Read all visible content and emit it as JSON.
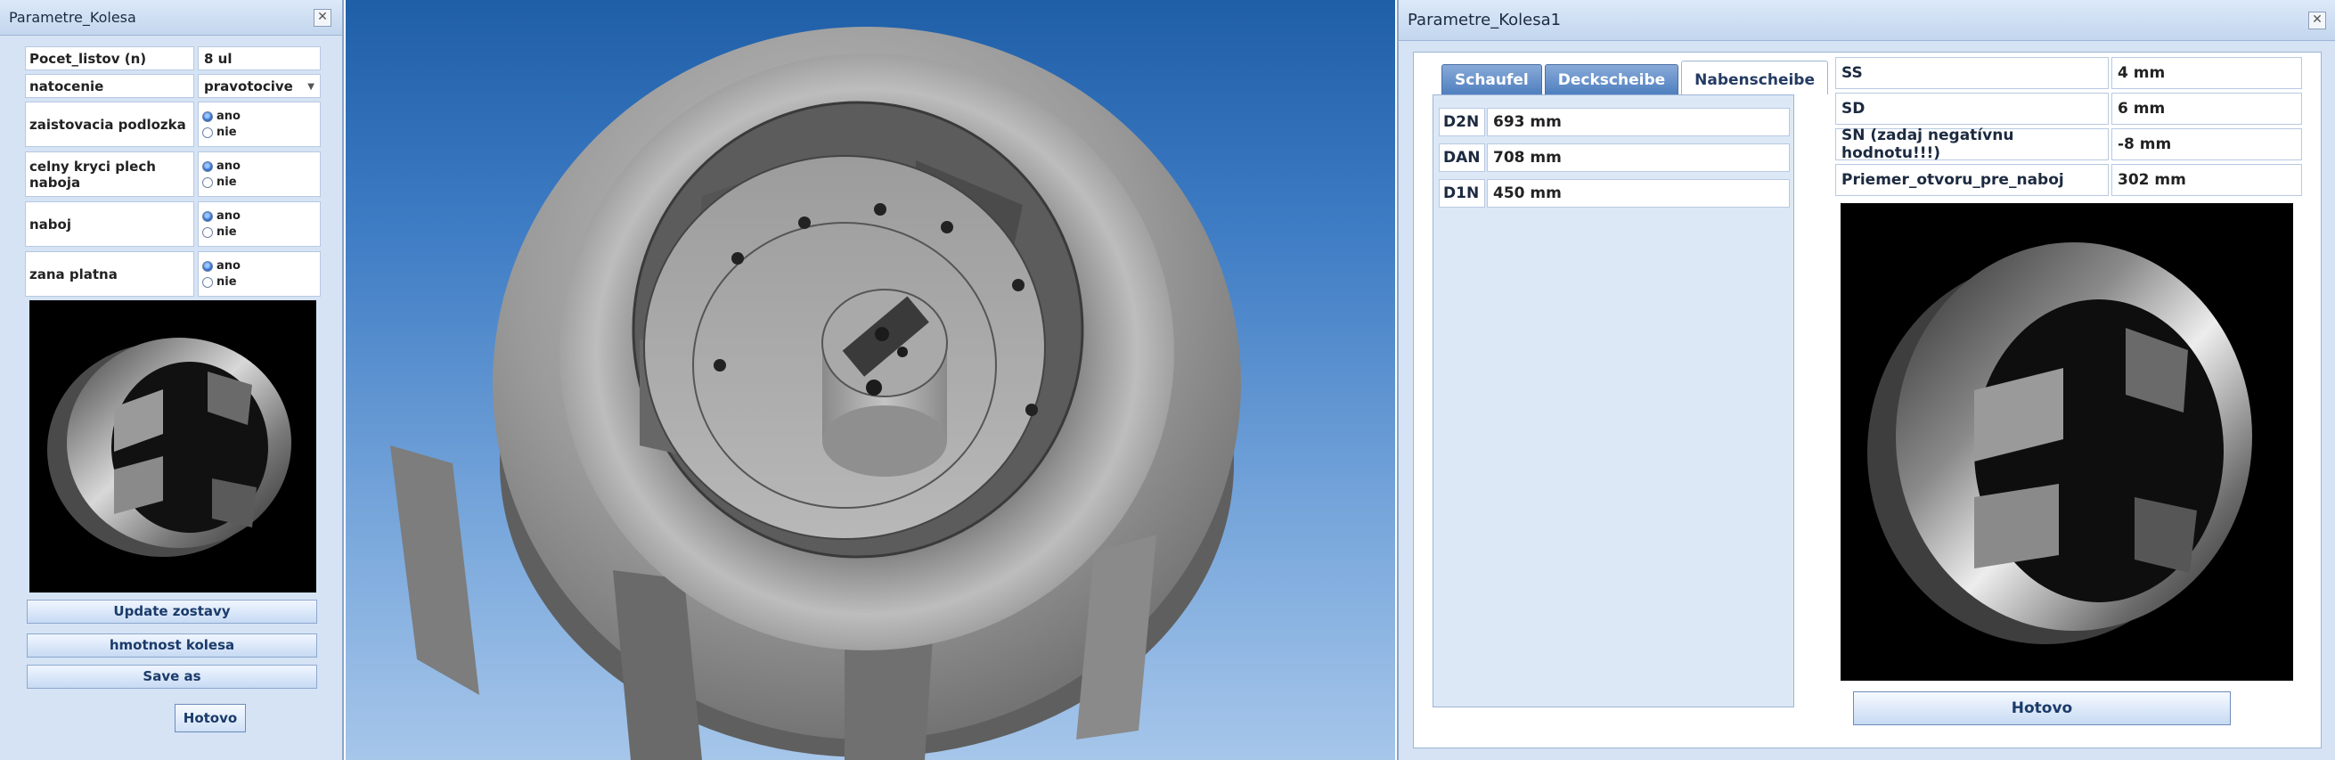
{
  "left_panel": {
    "title": "Parametre_Kolesa",
    "close_glyph": "✕",
    "fields": [
      {
        "label": "Pocet_listov (n)",
        "value": "8 ul"
      },
      {
        "label": "natocenie",
        "value": "pravotocive"
      },
      {
        "label": "zaistovacia podlozka",
        "options": [
          "ano",
          "nie"
        ],
        "selected": "ano"
      },
      {
        "label": "celny kryci plech naboja",
        "options": [
          "ano",
          "nie"
        ],
        "selected": "ano"
      },
      {
        "label": "naboj",
        "options": [
          "ano",
          "nie"
        ],
        "selected": "ano"
      },
      {
        "label": "zana platna",
        "options": [
          "ano",
          "nie"
        ],
        "selected": "ano"
      }
    ],
    "buttons": {
      "update": "Update zostavy",
      "mass": "hmotnost kolesa",
      "save_as": "Save as",
      "done": "Hotovo"
    }
  },
  "right_panel": {
    "title": "Parametre_Kolesa1",
    "close_glyph": "✕",
    "tabs": [
      {
        "label": "Schaufel",
        "active": false
      },
      {
        "label": "Deckscheibe",
        "active": false
      },
      {
        "label": "Nabenscheibe",
        "active": true
      }
    ],
    "nabenscheibe": [
      {
        "label": "D2N",
        "value": "693 mm"
      },
      {
        "label": "DAN",
        "value": "708 mm"
      },
      {
        "label": "D1N",
        "value": "450 mm"
      }
    ],
    "params": [
      {
        "label": "SS",
        "value": "4 mm"
      },
      {
        "label": "SD",
        "value": "6 mm"
      },
      {
        "label": "SN (zadaj negatívnu hodnotu!!!)",
        "value": "-8 mm"
      },
      {
        "label": "Priemer_otvoru_pre_naboj",
        "value": "302 mm"
      }
    ],
    "done_button": "Hotovo"
  },
  "colors": {
    "panel_bg": "#d5e3f4",
    "viewport_top": "#1f5fa8",
    "viewport_bottom": "#a6c6ea",
    "tab_active_text": "#243b63"
  }
}
